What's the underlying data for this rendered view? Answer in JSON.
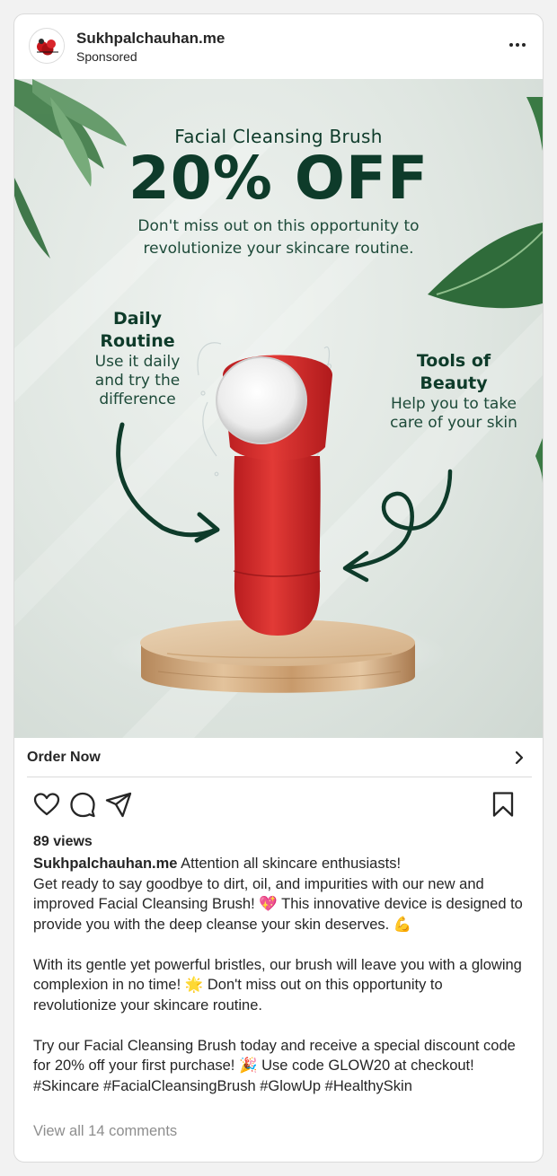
{
  "post": {
    "account_name": "Sukhpalchauhan.me",
    "sponsored_label": "Sponsored",
    "views": "89 views",
    "cta_label": "Order Now",
    "comments_link": "View all 14 comments"
  },
  "creative": {
    "kicker": "Facial Cleansing Brush",
    "discount": "20% OFF",
    "subtitle": "Don't miss out on this opportunity to revolutionize your skincare routine.",
    "left_heading_line1": "Daily",
    "left_heading_line2": "Routine",
    "left_body_line1": "Use it daily",
    "left_body_line2": "and try the",
    "left_body_line3": "difference",
    "right_heading_line1": "Tools of",
    "right_heading_line2": "Beauty",
    "right_body_line1": "Help you to take",
    "right_body_line2": "care of your skin"
  },
  "caption": {
    "username": "Sukhpalchauhan.me",
    "line1": " Attention all skincare enthusiasts!",
    "para1": "Get ready to say goodbye to dirt, oil, and impurities with our new and improved Facial Cleansing Brush! 💖 This innovative device is designed to provide you with the deep cleanse your skin deserves. 💪",
    "para2": "With its gentle yet powerful bristles, our brush will leave you with a glowing complexion in no time! 🌟 Don't miss out on this opportunity to revolutionize your skincare routine.",
    "para3": "Try our Facial Cleansing Brush today and receive a special discount code for 20% off your first purchase! 🎉 Use code GLOW20 at checkout!",
    "hashtags": "#Skincare #FacialCleansingBrush #GlowUp #HealthySkin"
  },
  "icons": {
    "more": "more-options-icon",
    "chevron": "chevron-right-icon",
    "like": "heart-icon",
    "comment": "comment-icon",
    "share": "share-icon",
    "save": "bookmark-icon"
  },
  "colors": {
    "ad_green": "#0e3b2a",
    "brush_red": "#d42a2a",
    "leaf_green": "#2f6b3a",
    "text": "#262626",
    "muted": "#8e8e8e"
  }
}
